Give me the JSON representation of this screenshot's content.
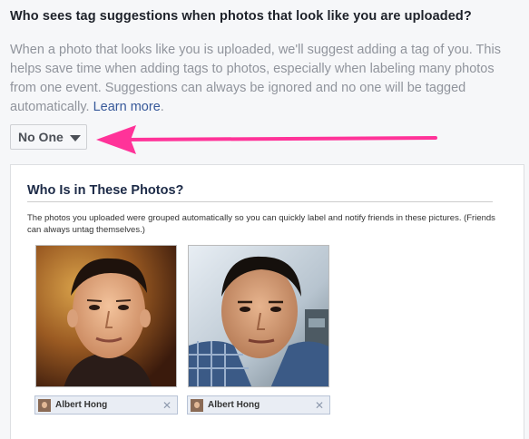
{
  "section": {
    "heading": "Who sees tag suggestions when photos that look like you are uploaded?",
    "description": "When a photo that looks like you is uploaded, we'll suggest adding a tag of you. This helps save time when adding tags to photos, especially when labeling many photos from one event. Suggestions can always be ignored and no one will be tagged automatically.",
    "learn_more": "Learn more",
    "period": "."
  },
  "audience_dropdown": {
    "selected": "No One"
  },
  "annotation": {
    "arrow_color": "#ff3399"
  },
  "preview": {
    "title": "Who Is in These Photos?",
    "text": "The photos you uploaded were grouped automatically so you can quickly label and notify friends in these pictures. (Friends can always untag themselves.)",
    "photos": [
      {
        "tag_name": "Albert Hong",
        "remove_icon": "close-icon"
      },
      {
        "tag_name": "Albert Hong",
        "remove_icon": "close-icon"
      }
    ]
  },
  "colors": {
    "link": "#365899",
    "heading": "#1d2129",
    "muted_text": "#90949c"
  }
}
